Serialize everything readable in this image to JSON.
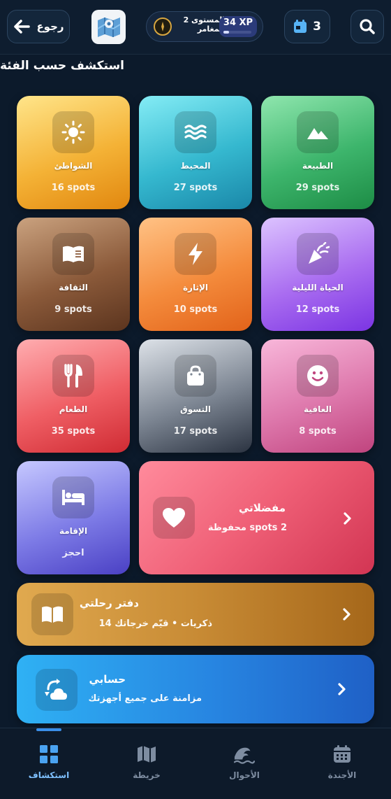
{
  "header": {
    "back_label": "رجوع",
    "level_line1": "المستوى 2",
    "level_line2": "المغامر",
    "xp_label": "34 XP",
    "xp_progress": 0.2,
    "calendar_count": "3"
  },
  "section_title": "استكشف حسب الفئة",
  "categories": [
    {
      "name": "الطبيعة",
      "count": "29 spots",
      "icon": "mountain-icon"
    },
    {
      "name": "المحيط",
      "count": "27 spots",
      "icon": "waves-icon"
    },
    {
      "name": "الشواطئ",
      "count": "16 spots",
      "icon": "sun-icon"
    },
    {
      "name": "الحياة الليلية",
      "count": "12 spots",
      "icon": "party-popper-icon"
    },
    {
      "name": "الإثارة",
      "count": "10 spots",
      "icon": "lightning-icon"
    },
    {
      "name": "الثقافة",
      "count": "9 spots",
      "icon": "book-icon"
    },
    {
      "name": "العافية",
      "count": "8 spots",
      "icon": "smiley-icon"
    },
    {
      "name": "التسوق",
      "count": "17 spots",
      "icon": "shopping-bag-icon"
    },
    {
      "name": "الطعام",
      "count": "35 spots",
      "icon": "utensils-icon"
    },
    {
      "name": "الإقامة",
      "count": "احجز",
      "icon": "bed-icon"
    }
  ],
  "favorites": {
    "title": "مفضلاتي",
    "subtitle": "2 spots محفوظة",
    "icon": "heart-icon"
  },
  "journal": {
    "title": "دفتر رحلتي",
    "subtitle": "ذكريات • قيّم خرجاتك 14",
    "icon": "open-book-icon"
  },
  "account": {
    "title": "حسابي",
    "subtitle": "مزامنة على جميع أجهزتك",
    "icon": "sync-cloud-icon"
  },
  "bottom_nav": [
    {
      "label": "استكشاف",
      "icon": "grid-icon",
      "active": true
    },
    {
      "label": "خريطة",
      "icon": "map-icon",
      "active": false
    },
    {
      "label": "الأحوال",
      "icon": "wave-icon",
      "active": false
    },
    {
      "label": "الأجندة",
      "icon": "calendar-icon",
      "active": false
    }
  ],
  "colors": {
    "background": "#0c1a2b",
    "active_nav": "#7fc1ff",
    "inactive_nav": "#7e8da1"
  }
}
